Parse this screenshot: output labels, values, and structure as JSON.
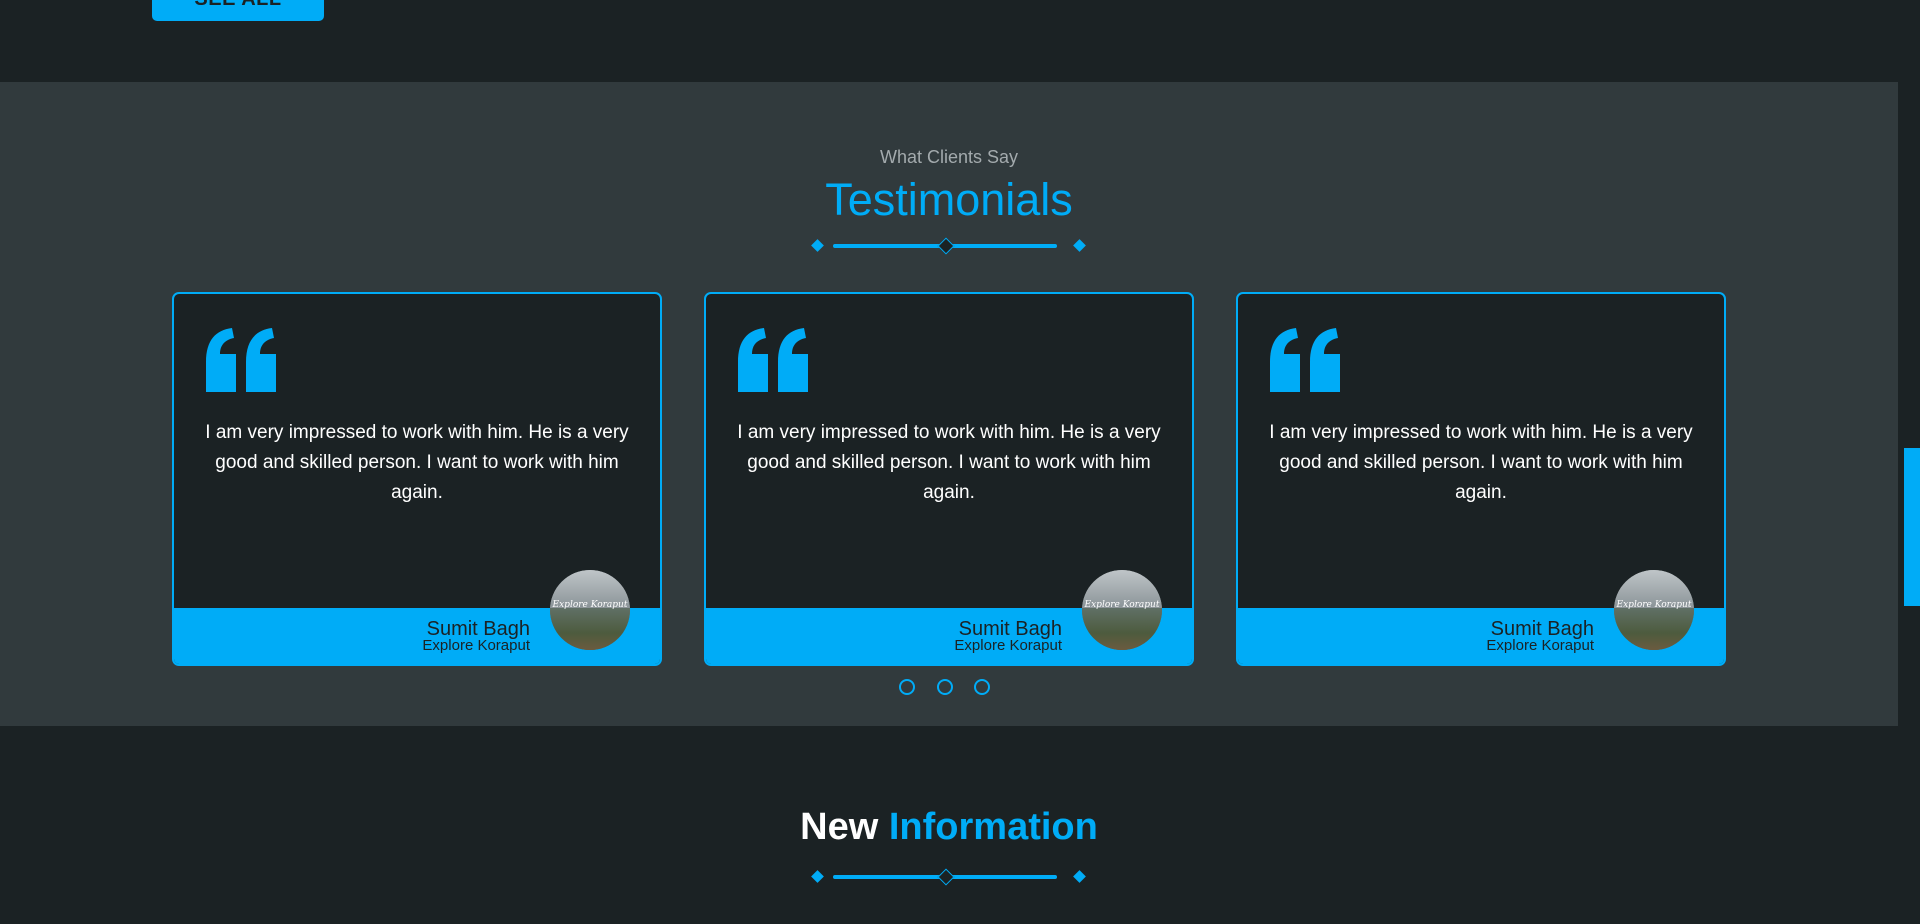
{
  "top": {
    "see_all_label": "SEE ALL"
  },
  "testimonials": {
    "subtitle": "What Clients Say",
    "title": "Testimonials",
    "cards": [
      {
        "text": "I am very impressed to work with him. He is a very good and skilled person. I want to work with him again.",
        "name": "Sumit Bagh",
        "org": "Explore Koraput",
        "avatar_text": "Explore Koraput"
      },
      {
        "text": "I am very impressed to work with him. He is a very good and skilled person. I want to work with him again.",
        "name": "Sumit Bagh",
        "org": "Explore Koraput",
        "avatar_text": "Explore Koraput"
      },
      {
        "text": "I am very impressed to work with him. He is a very good and skilled person. I want to work with him again.",
        "name": "Sumit Bagh",
        "org": "Explore Koraput",
        "avatar_text": "Explore Koraput"
      }
    ],
    "pagination_count": 3
  },
  "info": {
    "title_part1": "New",
    "title_part2": "Information"
  },
  "colors": {
    "accent": "#00acf7",
    "bg_dark": "#1b2224",
    "bg_section": "#313a3d",
    "muted_text": "#a3aaad"
  },
  "icons": {
    "quote": "quote-icon",
    "divider": "diamond-divider-icon"
  }
}
